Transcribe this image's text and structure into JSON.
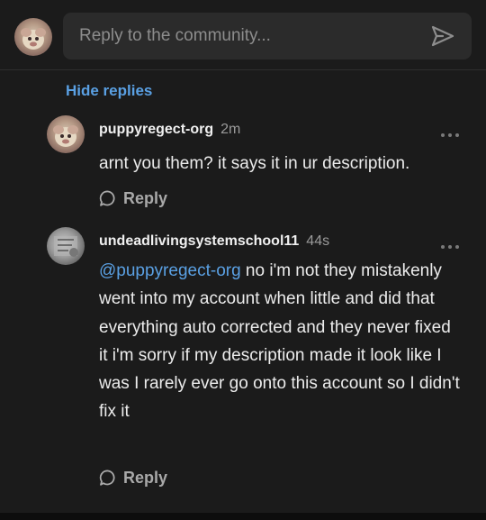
{
  "compose": {
    "placeholder": "Reply to the community...",
    "avatar_icon": "user-avatar",
    "send_icon": "send-icon"
  },
  "thread": {
    "hide_replies_label": "Hide replies"
  },
  "replies": [
    {
      "username": "puppyregect-org",
      "time": "2m",
      "text": "arnt you them? it says it in ur description.",
      "reply_label": "Reply"
    },
    {
      "username": "undeadlivingsystemschool11",
      "time": "44s",
      "mention": "@puppyregect-org",
      "text": " no i'm not they mistakenly went into my account when little and did that everything auto corrected and they never fixed it i'm sorry if my description made it look like I was I rarely ever go onto this account so I didn't fix it",
      "reply_label": "Reply"
    }
  ],
  "colors": {
    "background": "#1b1b1b",
    "accent": "#5aa0e3",
    "input_bg": "#2b2b2b"
  }
}
